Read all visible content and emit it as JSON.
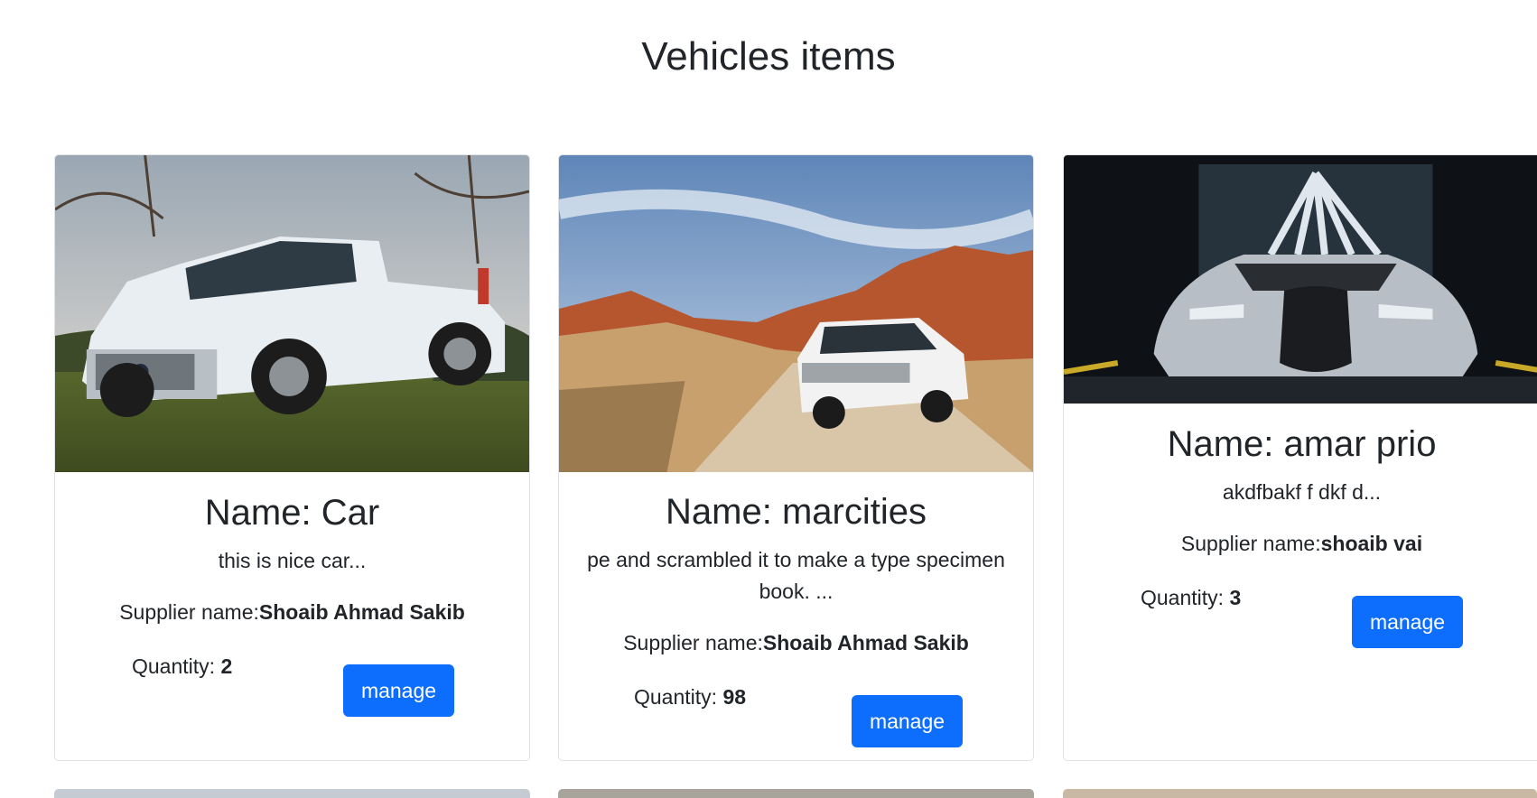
{
  "page": {
    "title": "Vehicles items"
  },
  "labels": {
    "supplier": "Supplier name:",
    "quantity": "Quantity: ",
    "manage": "manage"
  },
  "cards": [
    {
      "name": "Name: Car",
      "description": "this is nice car...",
      "supplier": "Shoaib Ahmad Sakib",
      "quantity": "2"
    },
    {
      "name": "Name: marcities",
      "description": "pe and scrambled it to make a type specimen book. ...",
      "supplier": "Shoaib Ahmad Sakib",
      "quantity": "98"
    },
    {
      "name": "Name: amar prio",
      "description": "akdfbakf f dkf d...",
      "supplier": "shoaib vai",
      "quantity": "3"
    }
  ],
  "colors": {
    "primary": "#0d6efd",
    "text": "#212529",
    "border": "#dfe2e6"
  }
}
